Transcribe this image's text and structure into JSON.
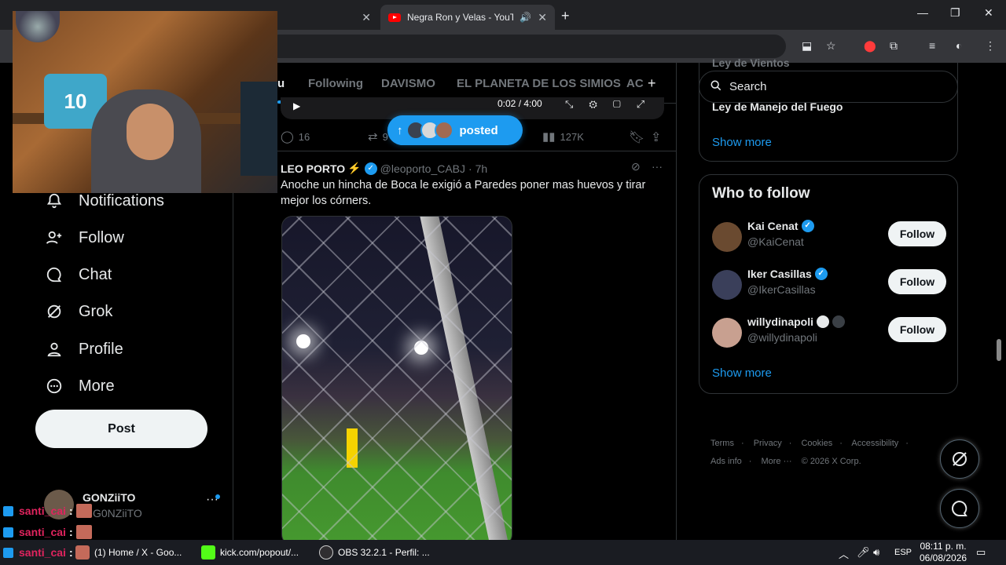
{
  "browser": {
    "tabs": [
      {
        "title": "",
        "active": false
      },
      {
        "title": "Negra Ron y Velas - YouTube",
        "active": true
      }
    ]
  },
  "leftnav": {
    "items": [
      {
        "label": "Notifications",
        "icon": "bell-icon"
      },
      {
        "label": "Follow",
        "icon": "person-plus-icon"
      },
      {
        "label": "Chat",
        "icon": "chat-bubble-icon"
      },
      {
        "label": "Grok",
        "icon": "grok-icon"
      },
      {
        "label": "Profile",
        "icon": "person-icon"
      },
      {
        "label": "More",
        "icon": "more-circle-icon"
      }
    ],
    "post_label": "Post",
    "account": {
      "name": "GONZiiTO",
      "handle": "G0NZiiTO"
    }
  },
  "chat_overlay": [
    {
      "user": "santi_cai"
    },
    {
      "user": "santi_cai"
    },
    {
      "user": "santi_cai"
    }
  ],
  "timeline": {
    "tabs": [
      "u",
      "Following",
      "DAVISMO",
      "EL PLANETA DE LOS SIMIOS",
      "AC"
    ],
    "video_time": "0:02 / 4:00",
    "actions": {
      "replies": "16",
      "reposts": "9",
      "views": "127K"
    },
    "posted_pill": "posted",
    "tweet": {
      "name": "LEO PORTO",
      "handle": "@leoporto_CABJ",
      "time": "· 7h",
      "text": "Anoche un hincha de Boca le exigió a Paredes poner mas huevos y tirar mejor los córners."
    }
  },
  "right": {
    "search_placeholder": "Search",
    "trend_cut_top": "Ley de Vientos",
    "trend_cut": "Ley de Manejo del Fuego",
    "show_more": "Show more",
    "who_to_follow": {
      "title": "Who to follow",
      "users": [
        {
          "name": "Kai Cenat",
          "handle": "@KaiCenat",
          "verified": true,
          "follow": "Follow"
        },
        {
          "name": "Iker Casillas",
          "handle": "@IkerCasillas",
          "verified": true,
          "follow": "Follow"
        },
        {
          "name": "willydinapoli",
          "handle": "@willydinapoli",
          "verified": false,
          "follow": "Follow"
        }
      ],
      "show_more": "Show more"
    },
    "footer": [
      "Terms",
      "·",
      "Privacy",
      "·",
      "Cookies",
      "·",
      "Accessibility",
      "·"
    ],
    "footer2": [
      "Ads info",
      "·",
      "More ···",
      "© 2026 X Corp."
    ]
  },
  "taskbar": {
    "tasks": [
      {
        "label": "(1) Home / X - Goo..."
      },
      {
        "label": "kick.com/popout/..."
      },
      {
        "label": "OBS 32.2.1 - Perfil: ..."
      }
    ],
    "language": "ESP",
    "time": "08:11 p. m.",
    "date": "06/08/2026"
  },
  "colors": {
    "accent": "#1d9bf0",
    "background": "#000000",
    "chat_user": "#e0245e"
  }
}
